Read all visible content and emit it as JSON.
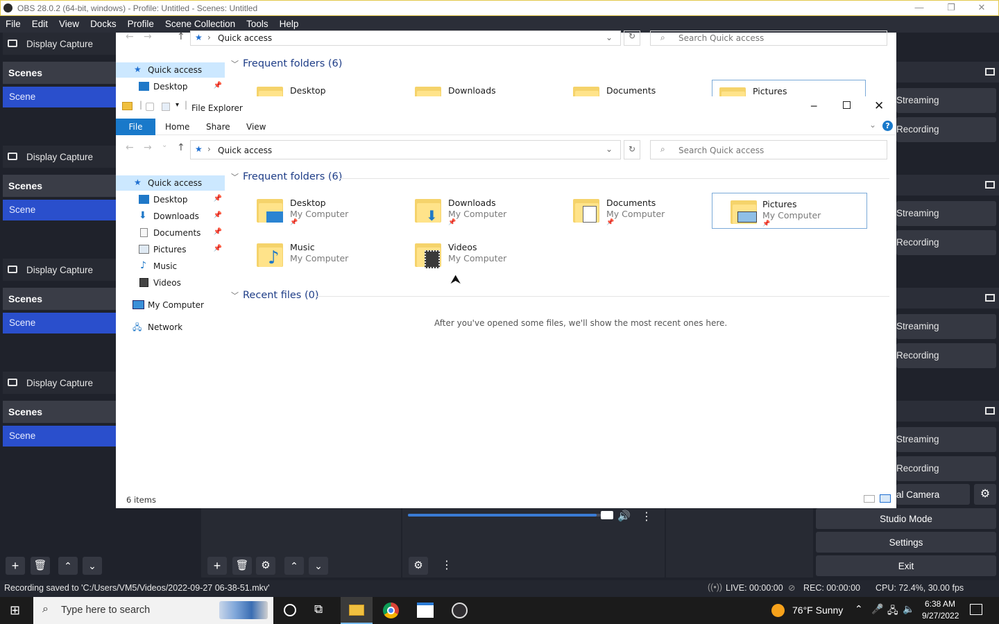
{
  "obs": {
    "title": "OBS 28.0.2 (64-bit, windows) - Profile: Untitled - Scenes: Untitled",
    "menu": [
      "File",
      "Edit",
      "View",
      "Docks",
      "Profile",
      "Scene Collection",
      "Tools",
      "Help"
    ],
    "source_label": "Display Capture",
    "scenes_header": "Scenes",
    "scene_item": "Scene",
    "streaming_label": "Streaming",
    "recording_label": "Recording",
    "virtual_camera_label": "al Camera",
    "studio_mode": "Studio Mode",
    "settings": "Settings",
    "exit": "Exit",
    "status": {
      "message": "Recording saved to 'C:/Users/VM5/Videos/2022-09-27 06-38-51.mkv'",
      "live": "LIVE: 00:00:00",
      "rec": "REC: 00:00:00",
      "cpu": "CPU: 72.4%, 30.00 fps"
    },
    "volume_fraction": 0.92
  },
  "explorer": {
    "title": "File Explorer",
    "ribbon_tabs": [
      "File",
      "Home",
      "Share",
      "View"
    ],
    "address": "Quick access",
    "search_placeholder": "Search Quick access",
    "nav": {
      "quick_access": "Quick access",
      "desktop": "Desktop",
      "downloads": "Downloads",
      "documents": "Documents",
      "pictures": "Pictures",
      "music": "Music",
      "videos": "Videos",
      "my_computer": "My Computer",
      "network": "Network"
    },
    "frequent_header": "Frequent folders (6)",
    "recent_header": "Recent files (0)",
    "recent_empty": "After you've opened some files, we'll show the most recent ones here.",
    "folder_location": "My Computer",
    "folders": [
      "Desktop",
      "Downloads",
      "Documents",
      "Pictures",
      "Music",
      "Videos"
    ],
    "item_count": "6 items"
  },
  "taskbar": {
    "search_placeholder": "Type here to search",
    "weather": "76°F  Sunny",
    "time": "6:38 AM",
    "date": "9/27/2022"
  }
}
